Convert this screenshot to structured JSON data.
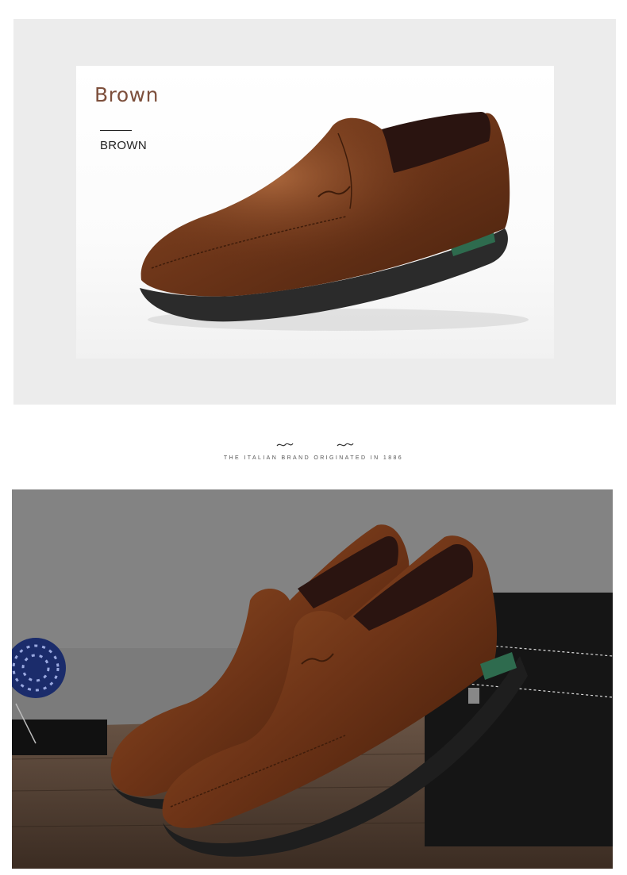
{
  "product": {
    "color_title": "Brown",
    "color_subtitle": "BROWN"
  },
  "divider": {
    "tagline": "THE ITALIAN BRAND ORIGINATED IN 1886"
  },
  "colors": {
    "panel_bg": "#ececec",
    "accent_brown": "#7d4f3c",
    "leather": "#6b3418",
    "sole": "#2b2b2b",
    "sole_accent": "#2e6b4e"
  },
  "icons": [
    "squiggle-ornament-icon",
    "squiggle-ornament-icon"
  ]
}
